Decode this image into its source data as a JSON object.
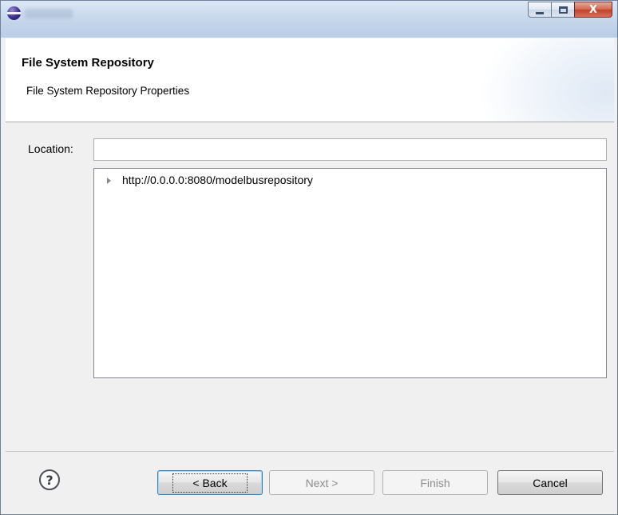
{
  "window": {
    "title": "",
    "controls": {
      "minimize": "minimize",
      "maximize": "maximize",
      "close": "X"
    }
  },
  "header": {
    "title": "File System Repository",
    "description": "File System Repository Properties"
  },
  "form": {
    "location_label": "Location:",
    "location_value": ""
  },
  "tree": {
    "items": [
      {
        "label": "http://0.0.0.0:8080/modelbusrepository",
        "expanded": false
      }
    ]
  },
  "footer": {
    "help_icon": "?",
    "back_label": "< Back",
    "next_label": "Next >",
    "finish_label": "Finish",
    "cancel_label": "Cancel",
    "next_enabled": false,
    "finish_enabled": false
  },
  "icons": {
    "app": "eclipse-icon",
    "help": "help-icon",
    "tree_toggle": "expand-arrow-icon"
  }
}
